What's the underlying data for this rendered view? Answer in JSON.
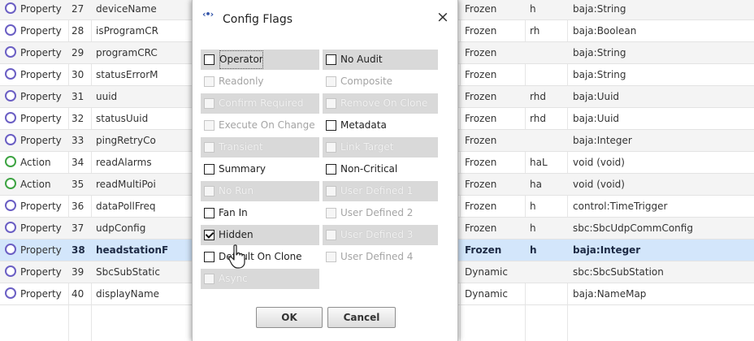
{
  "table": {
    "rows": [
      {
        "kind": "Property",
        "icon": "property-icon",
        "index": "27",
        "name": "deviceName",
        "state": "Frozen",
        "flags": "h",
        "type": "baja:String",
        "style": "alt"
      },
      {
        "kind": "Property",
        "icon": "property-icon",
        "index": "28",
        "name": "isProgramCR",
        "state": "Frozen",
        "flags": "rh",
        "type": "baja:Boolean",
        "style": ""
      },
      {
        "kind": "Property",
        "icon": "property-icon",
        "index": "29",
        "name": "programCRC",
        "state": "Frozen",
        "flags": "",
        "type": "baja:String",
        "style": "alt"
      },
      {
        "kind": "Property",
        "icon": "property-icon",
        "index": "30",
        "name": "statusErrorM",
        "state": "Frozen",
        "flags": "",
        "type": "baja:String",
        "style": ""
      },
      {
        "kind": "Property",
        "icon": "property-icon",
        "index": "31",
        "name": "uuid",
        "state": "Frozen",
        "flags": "rhd",
        "type": "baja:Uuid",
        "style": "alt"
      },
      {
        "kind": "Property",
        "icon": "property-icon",
        "index": "32",
        "name": "statusUuid",
        "state": "Frozen",
        "flags": "rhd",
        "type": "baja:Uuid",
        "style": ""
      },
      {
        "kind": "Property",
        "icon": "property-icon",
        "index": "33",
        "name": "pingRetryCo",
        "state": "Frozen",
        "flags": "",
        "type": "baja:Integer",
        "style": "alt"
      },
      {
        "kind": "Action",
        "icon": "action-icon",
        "index": "34",
        "name": "readAlarms",
        "state": "Frozen",
        "flags": "haL",
        "type": "void (void)",
        "style": ""
      },
      {
        "kind": "Action",
        "icon": "action-icon",
        "index": "35",
        "name": "readMultiPoi",
        "state": "Frozen",
        "flags": "ha",
        "type": "void (void)",
        "style": "alt"
      },
      {
        "kind": "Property",
        "icon": "property-icon",
        "index": "36",
        "name": "dataPollFreq",
        "state": "Frozen",
        "flags": "h",
        "type": "control:TimeTrigger",
        "style": ""
      },
      {
        "kind": "Property",
        "icon": "property-icon",
        "index": "37",
        "name": "udpConfig",
        "state": "Frozen",
        "flags": "h",
        "type": "sbc:SbcUdpCommConfig",
        "style": "alt"
      },
      {
        "kind": "Property",
        "icon": "property-icon",
        "index": "38",
        "name": "headstationF",
        "state": "Frozen",
        "flags": "h",
        "type": "baja:Integer",
        "style": "sel"
      },
      {
        "kind": "Property",
        "icon": "property-icon",
        "index": "39",
        "name": "SbcSubStatic",
        "state": "Dynamic",
        "flags": "",
        "type": "sbc:SbcSubStation",
        "style": "alt"
      },
      {
        "kind": "Property",
        "icon": "property-icon",
        "index": "40",
        "name": "displayName",
        "state": "Dynamic",
        "flags": "",
        "type": "baja:NameMap",
        "style": ""
      }
    ]
  },
  "dialog": {
    "title": "Config Flags",
    "icon": "config-flags-icon",
    "close_label": "×",
    "ok_label": "OK",
    "cancel_label": "Cancel",
    "flags_left": [
      {
        "label": "Operator",
        "checked": false,
        "disabled": false,
        "shaded": true,
        "focus": true
      },
      {
        "label": "Readonly",
        "checked": false,
        "disabled": true,
        "shaded": false
      },
      {
        "label": "Confirm Required",
        "checked": false,
        "disabled": true,
        "shaded": true
      },
      {
        "label": "Execute On Change",
        "checked": false,
        "disabled": true,
        "shaded": false
      },
      {
        "label": "Transient",
        "checked": false,
        "disabled": true,
        "shaded": true
      },
      {
        "label": "Summary",
        "checked": false,
        "disabled": false,
        "shaded": false
      },
      {
        "label": "No Run",
        "checked": false,
        "disabled": true,
        "shaded": true
      },
      {
        "label": "Fan In",
        "checked": false,
        "disabled": false,
        "shaded": false
      },
      {
        "label": "Hidden",
        "checked": true,
        "disabled": false,
        "shaded": true
      },
      {
        "label": "Default On Clone",
        "checked": false,
        "disabled": false,
        "shaded": false
      },
      {
        "label": "Async",
        "checked": false,
        "disabled": true,
        "shaded": true
      }
    ],
    "flags_right": [
      {
        "label": "No Audit",
        "checked": false,
        "disabled": false,
        "shaded": true
      },
      {
        "label": "Composite",
        "checked": false,
        "disabled": true,
        "shaded": false
      },
      {
        "label": "Remove On Clone",
        "checked": false,
        "disabled": true,
        "shaded": true
      },
      {
        "label": "Metadata",
        "checked": false,
        "disabled": false,
        "shaded": false
      },
      {
        "label": "Link Target",
        "checked": false,
        "disabled": true,
        "shaded": true
      },
      {
        "label": "Non-Critical",
        "checked": false,
        "disabled": false,
        "shaded": false
      },
      {
        "label": "User Defined 1",
        "checked": false,
        "disabled": true,
        "shaded": true
      },
      {
        "label": "User Defined 2",
        "checked": false,
        "disabled": true,
        "shaded": false
      },
      {
        "label": "User Defined 3",
        "checked": false,
        "disabled": true,
        "shaded": true
      },
      {
        "label": "User Defined 4",
        "checked": false,
        "disabled": true,
        "shaded": false
      }
    ]
  },
  "colors": {
    "property_circle": "#6b5fc4",
    "action_circle": "#3ea443",
    "selected_row": "#d3e6fb",
    "shaded_flag": "#d9d9d9"
  }
}
